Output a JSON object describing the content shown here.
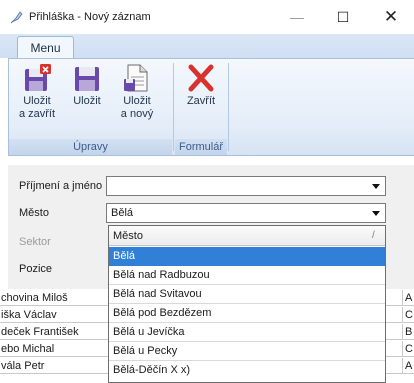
{
  "window": {
    "title": "Přihláška - Nový záznam",
    "controls": {
      "minimize": "—",
      "maximize": "☐",
      "close": "✕"
    }
  },
  "ribbon": {
    "tab": "Menu",
    "groups": [
      {
        "label": "Úpravy",
        "buttons": [
          {
            "line1": "Uložit",
            "line2": "a zavřít",
            "icon": "save-close-icon"
          },
          {
            "line1": "Uložit",
            "line2": "",
            "icon": "save-icon"
          },
          {
            "line1": "Uložit",
            "line2": "a nový",
            "icon": "save-new-icon"
          }
        ]
      },
      {
        "label": "Formulář",
        "buttons": [
          {
            "line1": "Zavřít",
            "line2": "",
            "icon": "close-x-icon"
          }
        ]
      }
    ]
  },
  "form": {
    "name_label": "Příjmení a jméno",
    "name_value": "",
    "city_label": "Město",
    "city_value": "Bělá",
    "sector_label": "Sektor",
    "position_label": "Pozice"
  },
  "grid_rows": [
    {
      "name": "chovina Miloš",
      "tail": "A"
    },
    {
      "name": "iška Václav",
      "tail": "C"
    },
    {
      "name": "deček František",
      "tail": "B"
    },
    {
      "name": "ebo Michal",
      "tail": "C"
    },
    {
      "name": "vála Petr",
      "tail": "A"
    }
  ],
  "dropdown": {
    "header": "Město",
    "sort_glyph": "/",
    "items": [
      "Bělá",
      "Bělá nad Radbuzou",
      "Bělá nad Svitavou",
      "Bělá pod Bezdězem",
      "Bělá u Jevíčka",
      "Bělá u Pecky",
      "Bělá-Děčín X x)"
    ],
    "selected_index": 0
  },
  "colors": {
    "selection": "#2f80d6",
    "ribbon": "#dbe7f5",
    "close_red": "#d8322f"
  }
}
